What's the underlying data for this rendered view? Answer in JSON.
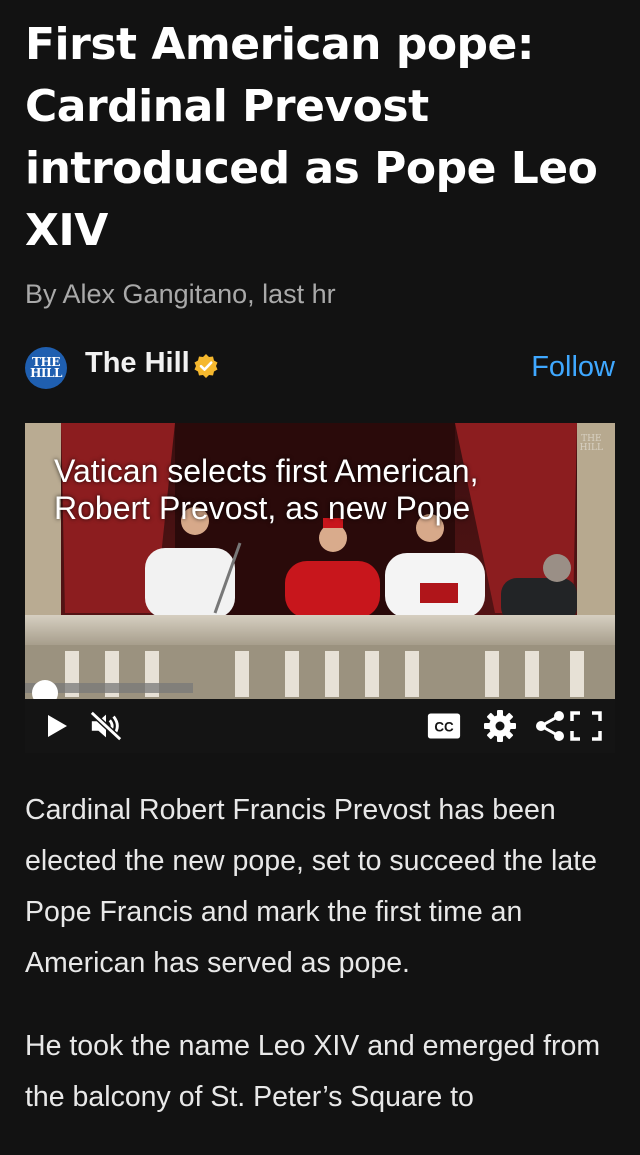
{
  "article": {
    "headline": "First American pope: Cardinal Prevost introduced as Pope Leo XIV",
    "byline": "By Alex Gangitano, last hr",
    "source": {
      "name": "The Hill",
      "logo_lines": [
        "THE",
        "HILL"
      ],
      "follow_label": "Follow",
      "verified": true
    },
    "video": {
      "caption_line1": "Vatican selects first American,",
      "caption_line2": "Robert Prevost, as new Pope",
      "watermark_lines": [
        "THE",
        "HILL"
      ],
      "progress": 0.03,
      "controls": [
        "play-icon",
        "muted-icon",
        "cc-icon",
        "settings-icon",
        "share-icon",
        "fullscreen-icon"
      ],
      "cc_label": "CC"
    },
    "paragraphs": [
      "Cardinal Robert Francis Prevost has been elected the new pope, set to succeed the late Pope Francis and mark the first time an American has served as pope.",
      "He took the name Leo XIV and emerged from the balcony of St. Peter’s Square to"
    ]
  },
  "colors": {
    "background": "#121212",
    "accent": "#3fa8ff",
    "verified_badge": "#f5b82e",
    "logo_blue": "#1f5fb0"
  }
}
